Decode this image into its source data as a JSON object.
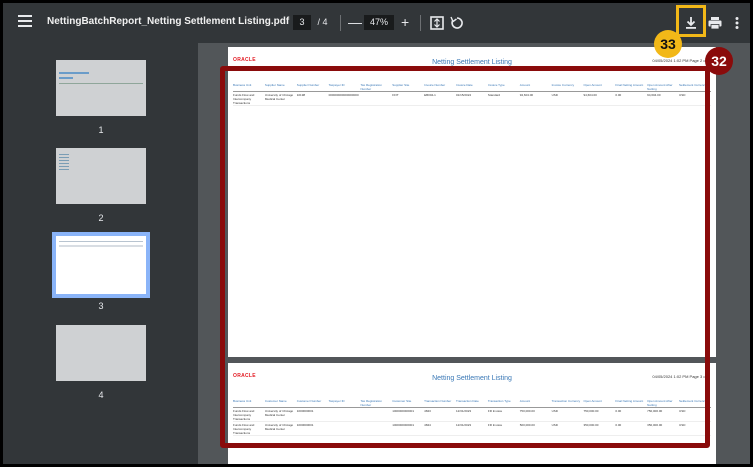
{
  "toolbar": {
    "filename": "NettingBatchReport_Netting Settlement Listing.pdf",
    "current_page": "3",
    "page_separator": "/",
    "total_pages": "4",
    "zoom_minus": "—",
    "zoom": "47%",
    "zoom_plus": "+"
  },
  "sidebar": {
    "thumbnails": [
      {
        "label": "1"
      },
      {
        "label": "2"
      },
      {
        "label": "3"
      },
      {
        "label": "4"
      }
    ]
  },
  "pages": [
    {
      "logo": "ORACLE",
      "title": "Netting Settlement Listing",
      "date": "04/05/2024 1:02 PM Page 2 of 3",
      "headers": [
        "Business Unit",
        "Supplier Name",
        "Supplier Number",
        "Taxpayer ID",
        "Tax Registration Number",
        "Supplier Site",
        "Invoice Number",
        "Invoice Date",
        "Invoice Type",
        "Amount",
        "Invoice Currency",
        "Open Amount",
        "Final Netting Amount",
        "Open Amount After Netting",
        "Settlement Currency"
      ],
      "rows": [
        [
          "Funds Flow and Intercompany Transactions",
          "University of Chicago Medical Center",
          "10198",
          "000000000000000000",
          "",
          "FFIT",
          "EB004-1",
          "01/15/2024",
          "Standard",
          "94,604.00",
          "USD",
          "94,604.00",
          "0.00",
          "94,604.00",
          "USD"
        ]
      ]
    },
    {
      "logo": "ORACLE",
      "title": "Netting Settlement Listing",
      "date": "04/05/2024 1:02 PM Page 3 of 3",
      "headers": [
        "Business Unit",
        "Customer Name",
        "Customer Number",
        "Taxpayer ID",
        "Tax Registration Number",
        "Customer Site",
        "Transaction Number",
        "Transaction Date",
        "Transaction Type",
        "Amount",
        "Transaction Currency",
        "Open Amount",
        "Final Netting Amount",
        "Open Amount After Netting",
        "Settlement Currency"
      ],
      "rows": [
        [
          "Funds Flow and Intercompany Transactions",
          "University of Chicago Medical Center",
          "1000000001",
          "",
          "",
          "1000000000001",
          "4843",
          "12/31/2023",
          "FR Invoice",
          "750,000.00",
          "USD",
          "750,000.00",
          "0.00",
          "750,000.00",
          "USD"
        ],
        [
          "Funds Flow and Intercompany Transactions",
          "University of Chicago Medical Center",
          "1000000001",
          "",
          "",
          "1000000000001",
          "4844",
          "12/31/2023",
          "FR Invoice",
          "500,000.00",
          "USD",
          "350,000.00",
          "0.00",
          "350,000.00",
          "USD"
        ]
      ]
    }
  ],
  "annotations": {
    "download_step": "33",
    "page_step": "32"
  },
  "colors": {
    "highlight_red": "#8a0b0b",
    "highlight_yellow": "#f2b818",
    "oracle_red": "#e31b23",
    "title_blue": "#3a78b6"
  }
}
